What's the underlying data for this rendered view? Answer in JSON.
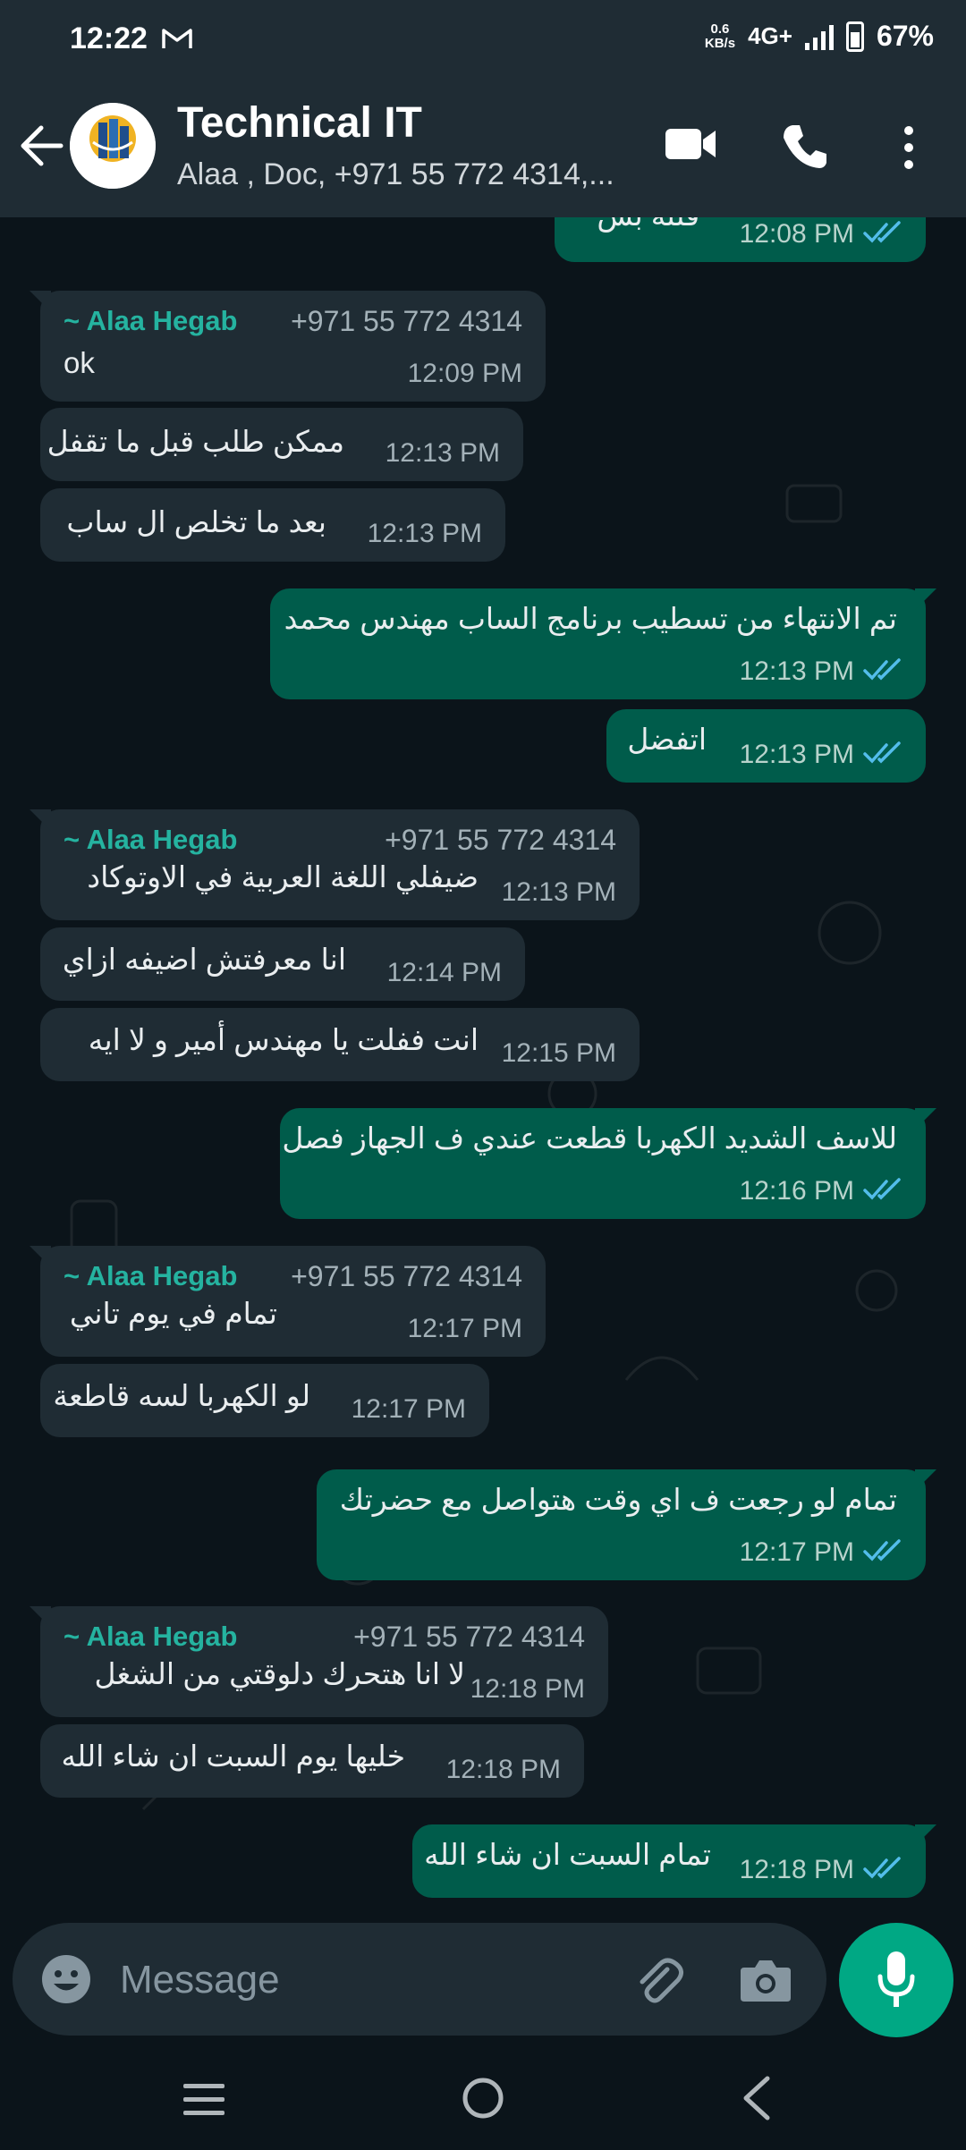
{
  "status_bar": {
    "time": "12:22",
    "speed_value": "0.6",
    "speed_unit": "KB/s",
    "network": "4G+",
    "battery": "67%"
  },
  "header": {
    "title": "Technical IT",
    "subtitle": "Alaa , Doc, +971 55 772 4314,...",
    "avatar_text": "RADIANCE GROUP"
  },
  "messages": [
    {
      "dir": "out",
      "text": "*فلته بس",
      "time": "12:08 PM"
    },
    {
      "dir": "in",
      "sender": "~ Alaa Hegab",
      "phone": "+971 55 772 4314",
      "text": "ok",
      "time": "12:09 PM"
    },
    {
      "dir": "in",
      "text": "ممكن طلب قبل ما تقفل",
      "time": "12:13 PM"
    },
    {
      "dir": "in",
      "text": "بعد ما تخلص ال ساب",
      "time": "12:13 PM"
    },
    {
      "dir": "out",
      "text": "تم الانتهاء من تسطيب برنامج الساب مهندس محمد",
      "time": "12:13 PM"
    },
    {
      "dir": "out",
      "text": "اتفضل",
      "time": "12:13 PM"
    },
    {
      "dir": "in",
      "sender": "~ Alaa Hegab",
      "phone": "+971 55 772 4314",
      "text": "ضيفلي اللغة العربية في الاوتوكاد",
      "time": "12:13 PM"
    },
    {
      "dir": "in",
      "text": "انا معرفتش اضيفه ازاي",
      "time": "12:14 PM"
    },
    {
      "dir": "in",
      "text": "انت ففلت يا مهندس أمير و لا ايه",
      "time": "12:15 PM"
    },
    {
      "dir": "out",
      "text": "للاسف الشديد الكهربا قطعت عندي ف الجهاز فصل",
      "time": "12:16 PM"
    },
    {
      "dir": "in",
      "sender": "~ Alaa Hegab",
      "phone": "+971 55 772 4314",
      "text": "تمام في يوم تاني",
      "time": "12:17 PM"
    },
    {
      "dir": "in",
      "text": "لو الكهربا لسه قاطعة",
      "time": "12:17 PM"
    },
    {
      "dir": "out",
      "text": "تمام لو رجعت ف اي وقت هتواصل مع حضرتك",
      "time": "12:17 PM"
    },
    {
      "dir": "in",
      "sender": "~ Alaa Hegab",
      "phone": "+971 55 772 4314",
      "text": "لا انا هتحرك دلوقتي من الشغل",
      "time": "12:18 PM"
    },
    {
      "dir": "in",
      "text": "خليها يوم السبت ان شاء الله",
      "time": "12:18 PM"
    },
    {
      "dir": "out",
      "text": "تمام السبت ان شاء الله",
      "time": "12:18 PM"
    }
  ],
  "input": {
    "placeholder": "Message"
  },
  "colors": {
    "incoming_bubble": "#1f2c34",
    "outgoing_bubble": "#005c4b",
    "accent": "#00a884",
    "sender_name": "#25b3a0",
    "read_ticks": "#53bdeb"
  }
}
